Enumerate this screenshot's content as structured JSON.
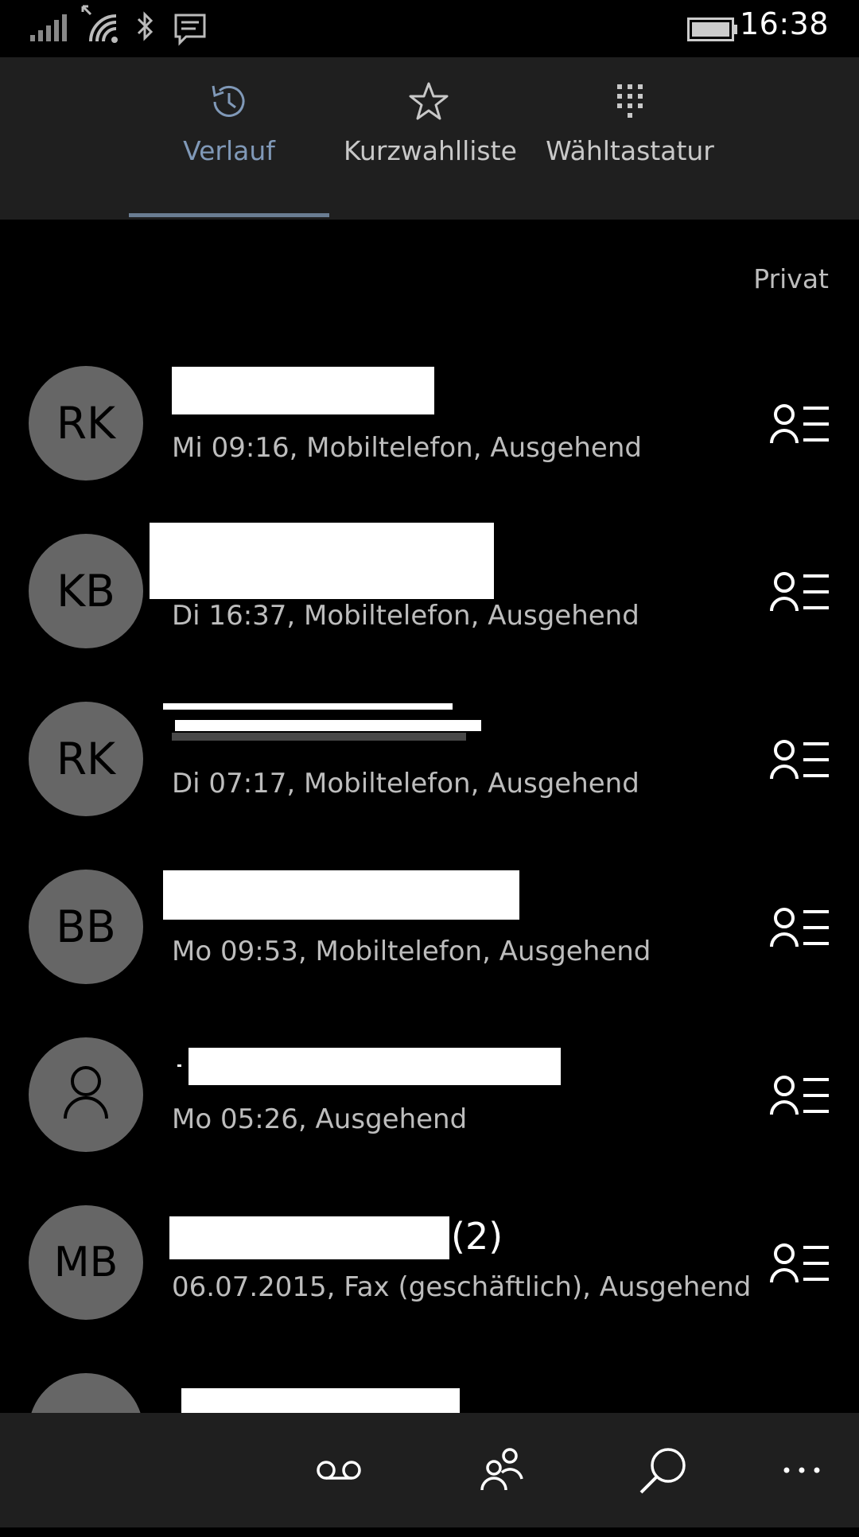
{
  "status_bar": {
    "time": "16:38",
    "icons": [
      "signal-icon",
      "wifi-icon",
      "bluetooth-icon",
      "message-icon",
      "battery-icon"
    ]
  },
  "tabs": [
    {
      "label": "Verlauf",
      "icon": "history-icon",
      "active": true
    },
    {
      "label": "Kurzwahlliste",
      "icon": "star-icon",
      "active": false
    },
    {
      "label": "Wähltastatur",
      "icon": "dialpad-icon",
      "active": false
    }
  ],
  "filter_label": "Privat",
  "calls": [
    {
      "initials": "RK",
      "detail": "Mi 09:16, Mobiltelefon, Ausgehend",
      "name_suffix": ""
    },
    {
      "initials": "KB",
      "detail": "Di 16:37, Mobiltelefon, Ausgehend",
      "name_suffix": ""
    },
    {
      "initials": "RK",
      "detail": "Di 07:17, Mobiltelefon, Ausgehend",
      "name_suffix": ""
    },
    {
      "initials": "BB",
      "detail": "Mo 09:53, Mobiltelefon, Ausgehend",
      "name_suffix": ""
    },
    {
      "initials": "",
      "detail": "Mo 05:26, Ausgehend",
      "name_suffix": ""
    },
    {
      "initials": "MB",
      "detail": "06.07.2015, Fax (geschäftlich), Ausgehend",
      "name_suffix": "(2)"
    },
    {
      "initials": "",
      "detail": "",
      "name_suffix": ""
    }
  ],
  "app_bar": {
    "buttons": [
      "voicemail-icon",
      "people-icon",
      "search-icon",
      "more-icon"
    ]
  },
  "colors": {
    "background": "#000000",
    "header_bg": "#1f1f1f",
    "accent": "#8099b8",
    "avatar_bg": "#666666",
    "secondary_text": "#bdbdbd"
  }
}
